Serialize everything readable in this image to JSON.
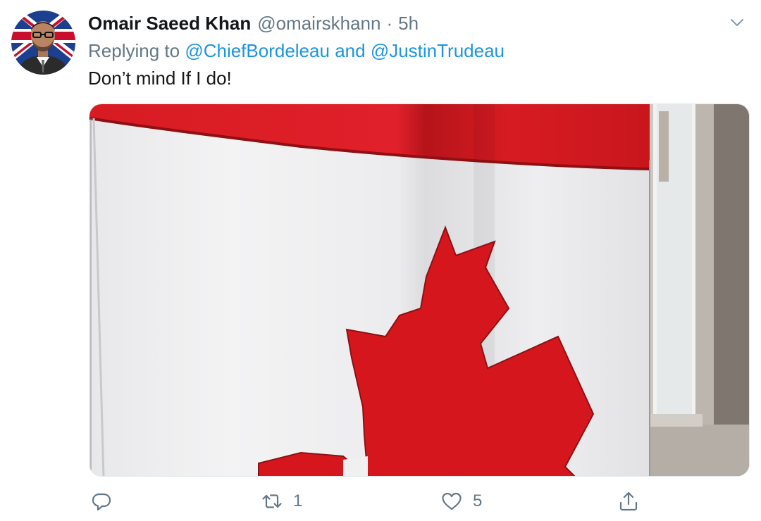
{
  "author": {
    "display_name": "Omair Saeed Khan",
    "handle": "@omairskhann",
    "separator": "·",
    "time": "5h"
  },
  "reply": {
    "prefix": "Replying to",
    "mentions": [
      "@ChiefBordeleau",
      "@JustinTrudeau"
    ],
    "conjunction": "and"
  },
  "tweet": {
    "text": "Don’t mind If I do!"
  },
  "media": {
    "description_icon": "canada-flag-photo"
  },
  "actions": {
    "reply_icon": "reply-icon",
    "retweet_icon": "retweet-icon",
    "retweet_count": "1",
    "like_icon": "heart-icon",
    "like_count": "5",
    "share_icon": "share-icon"
  },
  "colors": {
    "link": "#1b95e0",
    "secondary_text": "#657786",
    "primary_text": "#14171a",
    "flag_red": "#d9141c"
  }
}
